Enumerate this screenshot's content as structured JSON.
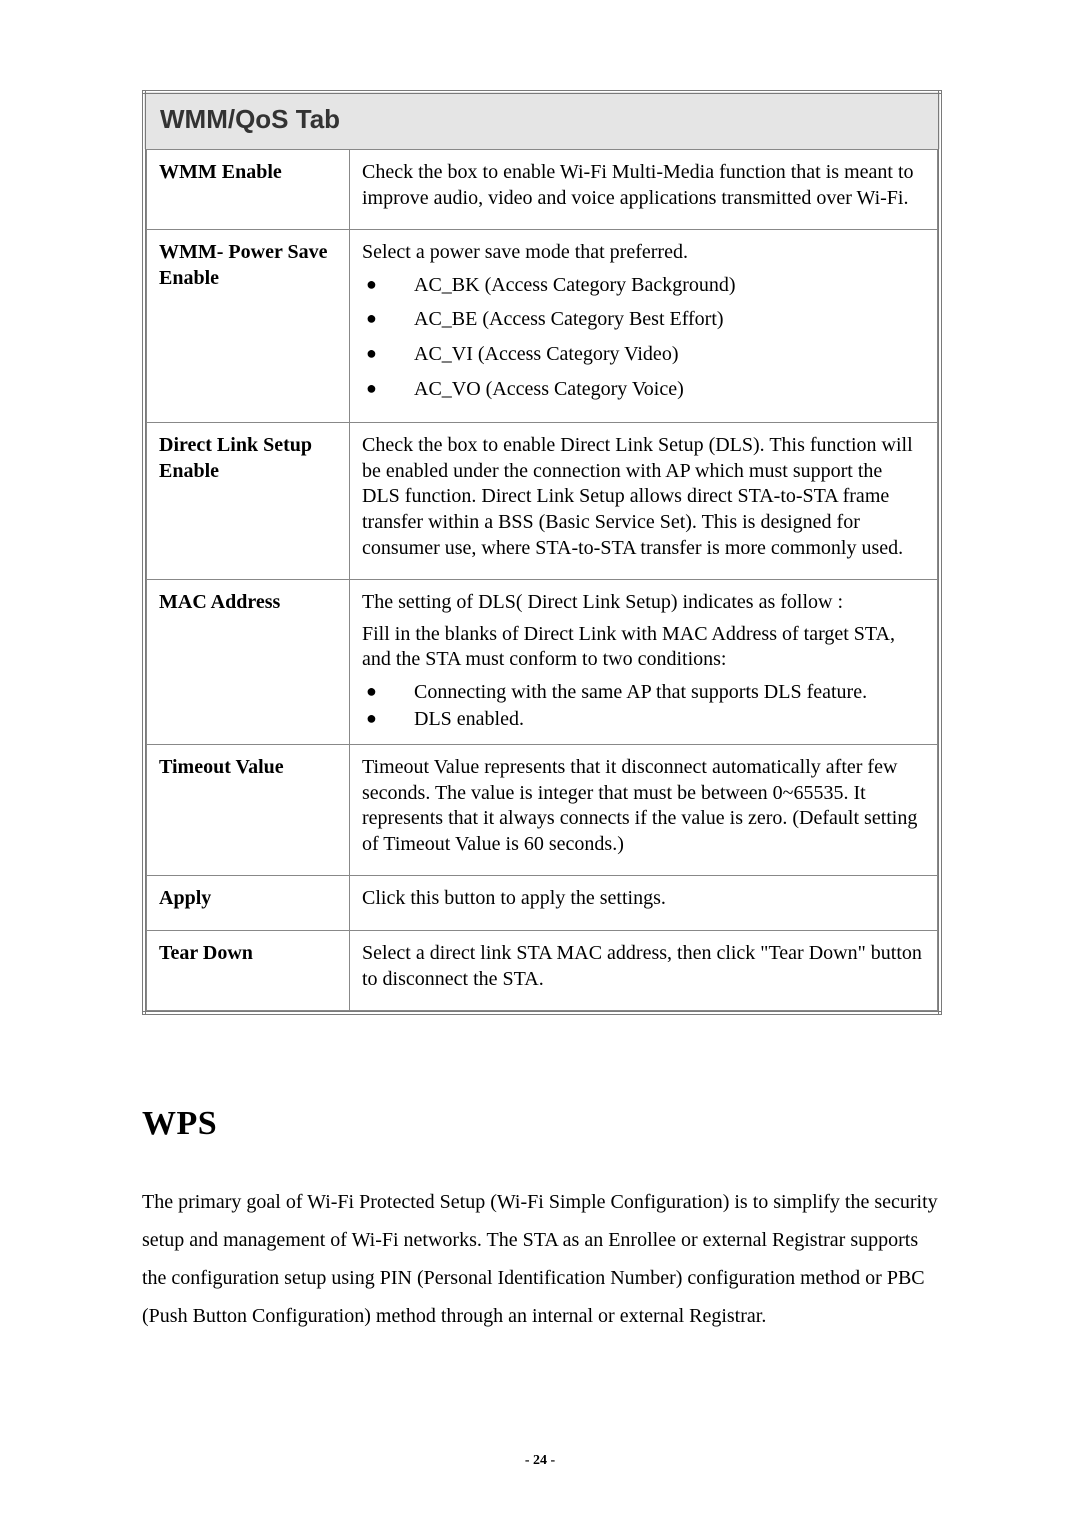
{
  "table": {
    "title": "WMM/QoS Tab",
    "rows": [
      {
        "label": "WMM Enable",
        "paras": [
          "Check the box to enable Wi-Fi Multi-Media function that is meant to improve audio, video and voice applications transmitted over Wi-Fi."
        ],
        "bullets": null
      },
      {
        "label": "WMM- Power Save Enable",
        "paras": [
          "Select a power save mode that preferred."
        ],
        "bullets": [
          "AC_BK (Access Category Background)",
          "AC_BE (Access Category Best Effort)",
          "AC_VI (Access Category Video)",
          "AC_VO (Access Category Voice)"
        ],
        "bullets_spaced": true
      },
      {
        "label": "Direct Link Setup Enable",
        "paras": [
          "Check the box to enable Direct Link Setup (DLS). This function will be enabled under the connection with AP which must support the DLS function. Direct Link Setup allows direct STA-to-STA frame transfer within a BSS (Basic Service Set). This is designed for consumer use, where STA-to-STA transfer is more commonly used."
        ],
        "bullets": null
      },
      {
        "label": "MAC Address",
        "paras": [
          "The setting of DLS( Direct Link Setup) indicates as follow :",
          "Fill in the blanks of Direct Link with MAC Address of target STA, and the STA must conform to two conditions:"
        ],
        "bullets": [
          "Connecting with the same AP that supports DLS feature.",
          "DLS enabled."
        ],
        "bullets_spaced": false
      },
      {
        "label": "Timeout Value",
        "paras": [
          "Timeout Value represents that it disconnect automatically after few seconds. The value is integer that must be between 0~65535. It represents that it always connects if the value is zero. (Default setting of Timeout Value is 60 seconds.)"
        ],
        "bullets": null
      },
      {
        "label": "Apply",
        "paras": [
          "Click this button to apply the settings."
        ],
        "bullets": null
      },
      {
        "label": "Tear Down",
        "paras": [
          "Select a direct link STA MAC address, then click \"Tear Down\" button to disconnect the STA."
        ],
        "bullets": null
      }
    ]
  },
  "section": {
    "heading": "WPS",
    "paragraph": "The primary goal of Wi-Fi Protected Setup (Wi-Fi Simple Configuration) is to simplify the security setup and management of Wi-Fi networks. The STA as an Enrollee or external Registrar supports the configuration setup using PIN (Personal Identification Number) configuration method or PBC (Push Button Configuration) method through an internal or external Registrar."
  },
  "pageNumber": "- 24 -"
}
